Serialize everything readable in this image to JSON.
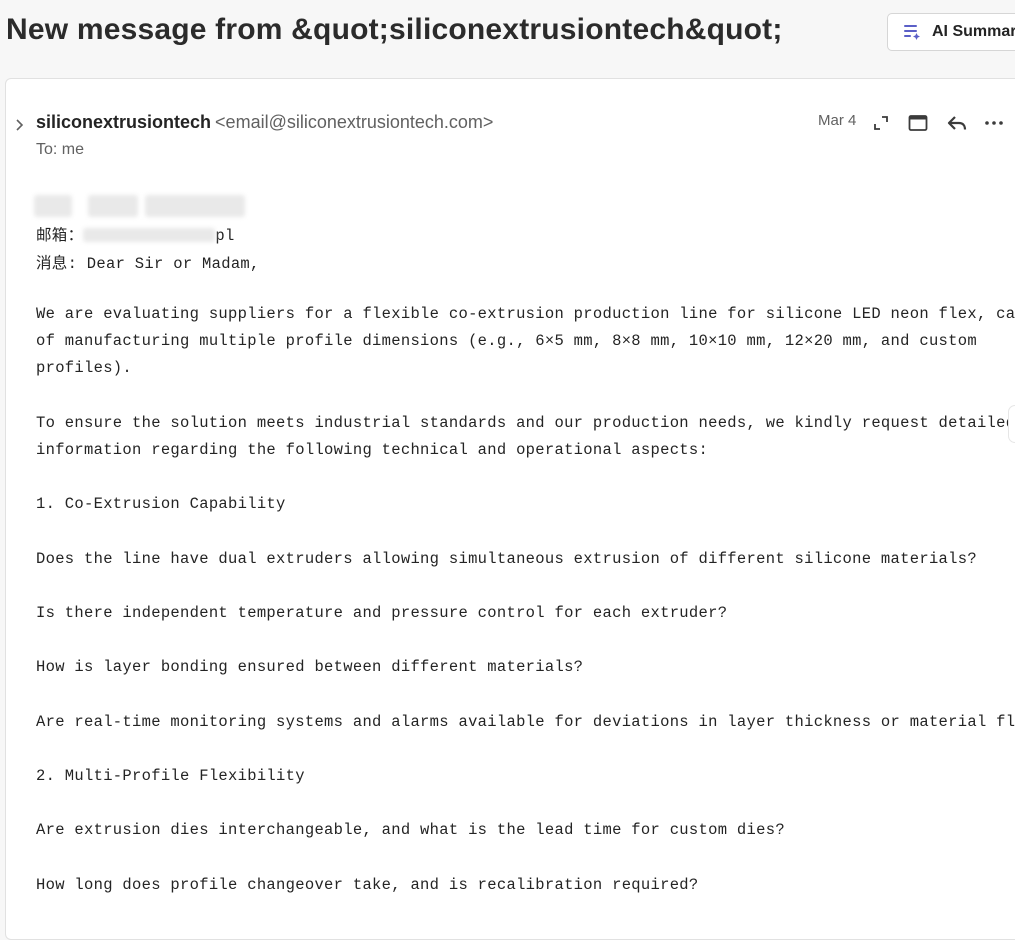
{
  "header": {
    "subject": "New message from &quot;siliconextrusiontech&quot;",
    "ai_summary_label": "AI Summar"
  },
  "message": {
    "sender_name": "siliconextrusiontech",
    "sender_email": "<email@siliconextrusiontech.com>",
    "to_line": "To: me",
    "date": "Mar 4",
    "body": {
      "email_prefix": "邮箱：",
      "email_suffix": "pl",
      "line_msg": "消息: Dear Sir or Madam,",
      "p1_l1": "We are evaluating suppliers for a flexible co-extrusion production line for silicone LED neon flex, capable",
      "p1_l2": "of manufacturing multiple profile dimensions (e.g., 6×5 mm, 8×8 mm, 10×10 mm, 12×20 mm, and custom",
      "p1_l3": "profiles).",
      "p2_l1": "To ensure the solution meets industrial standards and our production needs, we kindly request detailed",
      "p2_l2": "information regarding the following technical and operational aspects:",
      "h1": "1. Co-Extrusion Capability",
      "q1": "Does the line have dual extruders allowing simultaneous extrusion of different silicone materials?",
      "q2": "Is there independent temperature and pressure control for each extruder?",
      "q3": "How is layer bonding ensured between different materials?",
      "q4": "Are real-time monitoring systems and alarms available for deviations in layer thickness or material flow?",
      "h2": "2. Multi-Profile Flexibility",
      "q5": "Are extrusion dies interchangeable, and what is the lead time for custom dies?",
      "q6": "How long does profile changeover take, and is recalibration required?"
    }
  },
  "icons": {
    "ai": "ai-summary-icon",
    "expand": "expand-icon",
    "window": "open-window-icon",
    "reply": "reply-icon",
    "more": "more-icon",
    "chevron": "chevron-right-icon"
  },
  "colors": {
    "accent": "#5b5fc7",
    "text": "#242424",
    "muted": "#616161"
  }
}
